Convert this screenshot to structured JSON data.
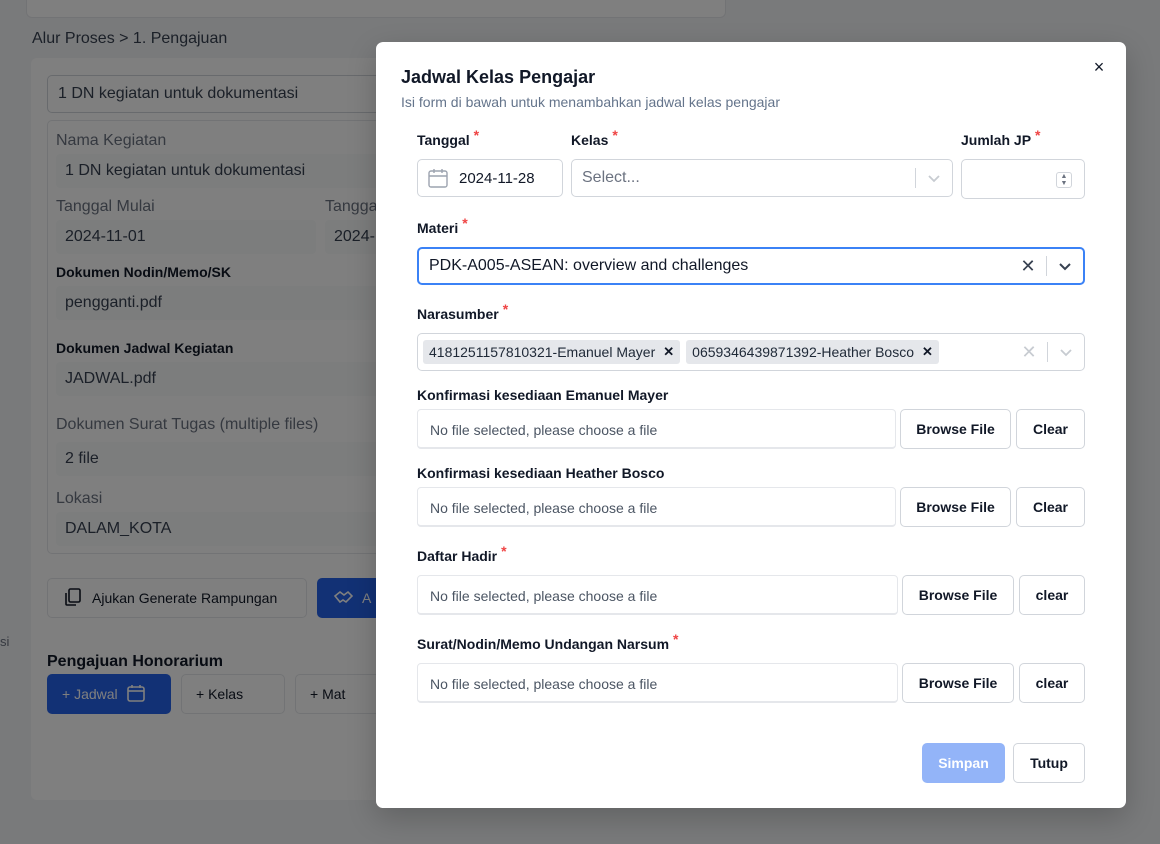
{
  "background": {
    "breadcrumb": "Alur Proses > 1. Pengajuan",
    "title_field": "1 DN kegiatan untuk dokumentasi",
    "nama_kegiatan_label": "Nama Kegiatan",
    "nama_kegiatan_value": "1 DN kegiatan untuk dokumentasi",
    "tanggal_mulai_label": "Tanggal Mulai",
    "tanggal_mulai_value": "2024-11-01",
    "tanggal_selesai_label": "Tangga",
    "tanggal_selesai_value": "2024-",
    "dok_nodin_label": "Dokumen Nodin/Memo/SK",
    "dok_nodin_value": "pengganti.pdf",
    "dok_jadwal_label": "Dokumen Jadwal Kegiatan",
    "dok_jadwal_value": "JADWAL.pdf",
    "dok_surat_label": "Dokumen Surat Tugas (multiple files)",
    "dok_surat_value": "2 file",
    "lokasi_label": "Lokasi",
    "lokasi_value": "DALAM_KOTA",
    "btn_generate": "Ajukan Generate Rampungan",
    "btn_generate2": "A",
    "section_honorarium": "Pengajuan Honorarium",
    "tab_jadwal": "+ Jadwal",
    "tab_kelas": "+ Kelas",
    "tab_materi": "+ Mat",
    "side_fragment": "si"
  },
  "modal": {
    "title": "Jadwal Kelas Pengajar",
    "subtitle": "Isi form di bawah untuk menambahkan jadwal kelas pengajar",
    "required_mark": "*",
    "tanggal": {
      "label": "Tanggal",
      "value": "2024-11-28"
    },
    "kelas": {
      "label": "Kelas",
      "placeholder": "Select..."
    },
    "jumlah_jp": {
      "label": "Jumlah JP",
      "value": ""
    },
    "materi": {
      "label": "Materi",
      "value": "PDK-A005-ASEAN: overview and challenges"
    },
    "narasumber": {
      "label": "Narasumber",
      "chips": [
        "4181251157810321-Emanuel Mayer",
        "0659346439871392-Heather Bosco"
      ]
    },
    "konfirmasi1": {
      "label": "Konfirmasi kesediaan Emanuel Mayer",
      "placeholder": "No file selected, please choose a file",
      "browse": "Browse File",
      "clear": "Clear"
    },
    "konfirmasi2": {
      "label": "Konfirmasi kesediaan Heather Bosco",
      "placeholder": "No file selected, please choose a file",
      "browse": "Browse File",
      "clear": "Clear"
    },
    "daftar_hadir": {
      "label": "Daftar Hadir",
      "placeholder": "No file selected, please choose a file",
      "browse": "Browse File",
      "clear": "clear"
    },
    "surat_undangan": {
      "label": "Surat/Nodin/Memo Undangan Narsum",
      "placeholder": "No file selected, please choose a file",
      "browse": "Browse File",
      "clear": "clear"
    },
    "btn_simpan": "Simpan",
    "btn_tutup": "Tutup",
    "close_symbol": "×"
  }
}
